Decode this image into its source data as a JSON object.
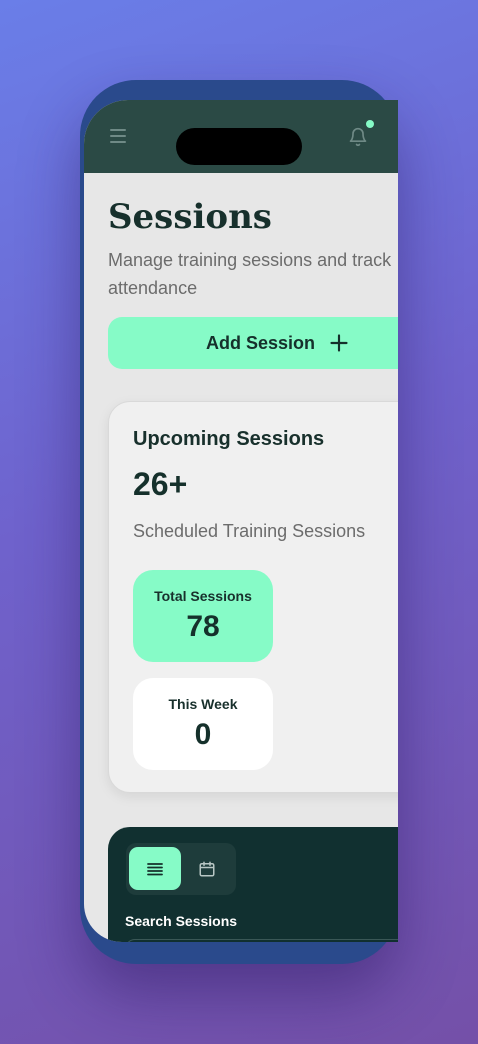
{
  "page": {
    "title": "Sessions",
    "subtitle": "Manage training sessions and track attendance"
  },
  "header": {
    "menu_icon": "hamburger-menu-icon",
    "notification_icon": "bell-icon",
    "notification_dot_color": "#86fbc7"
  },
  "actions": {
    "add_session_label": "Add Session",
    "add_icon": "plus-icon"
  },
  "upcoming": {
    "title": "Upcoming Sessions",
    "count": "26+",
    "description": "Scheduled Training Sessions",
    "stats": [
      {
        "label": "Total Sessions",
        "value": "78"
      },
      {
        "label": "This Week",
        "value": "0"
      }
    ]
  },
  "filters": {
    "view_toggle": [
      {
        "icon": "list-icon",
        "active": true
      },
      {
        "icon": "calendar-icon",
        "active": false
      }
    ],
    "search_label": "Search Sessions"
  },
  "colors": {
    "accent": "#86fbc7",
    "topbar": "#2b4a45",
    "panel": "#113030",
    "text_dark": "#15302b",
    "text_muted": "#6c6c6c"
  }
}
